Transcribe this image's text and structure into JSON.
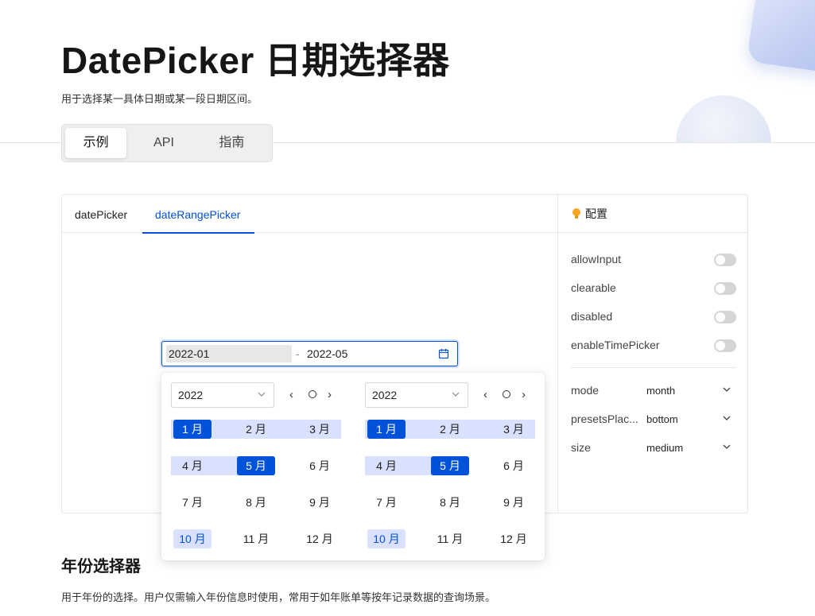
{
  "page": {
    "title": "DatePicker 日期选择器",
    "description": "用于选择某一具体日期或某一段日期区间。"
  },
  "top_tabs": [
    {
      "label": "示例",
      "active": true
    },
    {
      "label": "API",
      "active": false
    },
    {
      "label": "指南",
      "active": false
    }
  ],
  "demo": {
    "tabs": [
      {
        "label": "datePicker",
        "active": false
      },
      {
        "label": "dateRangePicker",
        "active": true
      }
    ]
  },
  "config": {
    "title": "配置",
    "switches": [
      {
        "label": "allowInput",
        "on": false
      },
      {
        "label": "clearable",
        "on": false
      },
      {
        "label": "disabled",
        "on": false
      },
      {
        "label": "enableTimePicker",
        "on": false
      }
    ],
    "selects": [
      {
        "label": "mode",
        "value": "month"
      },
      {
        "label": "presetsPlac...",
        "value": "bottom"
      },
      {
        "label": "size",
        "value": "medium"
      }
    ]
  },
  "range_input": {
    "start": "2022-01",
    "separator": "-",
    "end": "2022-05"
  },
  "popup": {
    "left": {
      "year": "2022"
    },
    "right": {
      "year": "2022"
    },
    "months": [
      "1 月",
      "2 月",
      "3 月",
      "4 月",
      "5 月",
      "6 月",
      "7 月",
      "8 月",
      "9 月",
      "10 月",
      "11 月",
      "12 月"
    ],
    "selected_start_month": "1 月",
    "selected_end_month": "5 月",
    "current_month": "10 月"
  },
  "section": {
    "title": "年份选择器",
    "description": "用于年份的选择。用户仅需输入年份信息时使用，常用于如年账单等按年记录数据的查询场景。"
  },
  "colors": {
    "primary": "#0052d9",
    "range_band": "#d9e1ff",
    "switch_off": "#d5d5d5"
  }
}
